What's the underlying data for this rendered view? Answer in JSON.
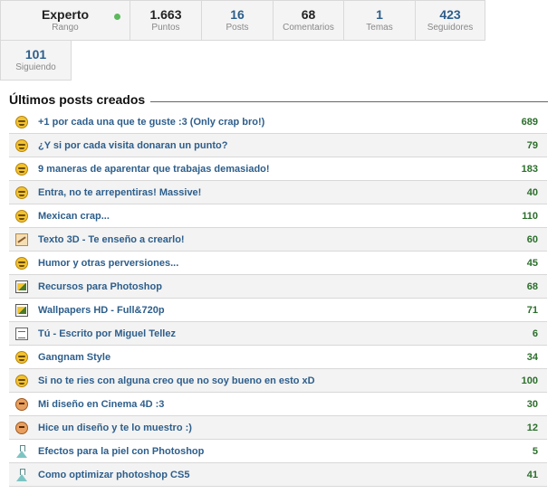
{
  "stats": [
    {
      "value": "Experto",
      "label": "Rango"
    },
    {
      "value": "1.663",
      "label": "Puntos"
    },
    {
      "value": "16",
      "label": "Posts"
    },
    {
      "value": "68",
      "label": "Comentarios"
    },
    {
      "value": "1",
      "label": "Temas"
    },
    {
      "value": "423",
      "label": "Seguidores"
    },
    {
      "value": "101",
      "label": "Siguiendo"
    }
  ],
  "section": {
    "title": "Últimos posts creados"
  },
  "posts": [
    {
      "icon": "smiley-icon",
      "title": "+1 por cada una que te guste :3 (Only crap bro!)",
      "points": "689"
    },
    {
      "icon": "smiley-icon",
      "title": "¿Y si por cada visita donaran un punto?",
      "points": "79"
    },
    {
      "icon": "smiley-icon",
      "title": "9 maneras de aparentar que trabajas demasiado!",
      "points": "183"
    },
    {
      "icon": "smiley-icon",
      "title": "Entra, no te arrepentiras! Massive!",
      "points": "40"
    },
    {
      "icon": "smiley-icon",
      "title": "Mexican crap...",
      "points": "110"
    },
    {
      "icon": "design-icon",
      "title": "Texto 3D - Te enseño a crearlo!",
      "points": "60"
    },
    {
      "icon": "smiley-icon",
      "title": "Humor y otras perversiones...",
      "points": "45"
    },
    {
      "icon": "image-icon",
      "title": "Recursos para Photoshop",
      "points": "68"
    },
    {
      "icon": "image-icon",
      "title": "Wallpapers HD - Full&720p",
      "points": "71"
    },
    {
      "icon": "document-icon",
      "title": "Tú - Escrito por Miguel Tellez",
      "points": "6"
    },
    {
      "icon": "smiley-icon",
      "title": "Gangnam Style",
      "points": "34"
    },
    {
      "icon": "smiley-icon",
      "title": "Si no te ries con alguna creo que no soy bueno en esto xD",
      "points": "100"
    },
    {
      "icon": "face-icon",
      "title": "Mi diseño en Cinema 4D :3",
      "points": "30"
    },
    {
      "icon": "face-icon",
      "title": "Hice un diseño y te lo muestro :)",
      "points": "12"
    },
    {
      "icon": "flask-icon",
      "title": "Efectos para la piel con Photoshop",
      "points": "5"
    },
    {
      "icon": "flask-icon",
      "title": "Como optimizar photoshop CS5",
      "points": "41"
    }
  ],
  "colors": {
    "link": "#2d5e8b",
    "points": "#2b6e2b",
    "online": "#5cb85c"
  }
}
